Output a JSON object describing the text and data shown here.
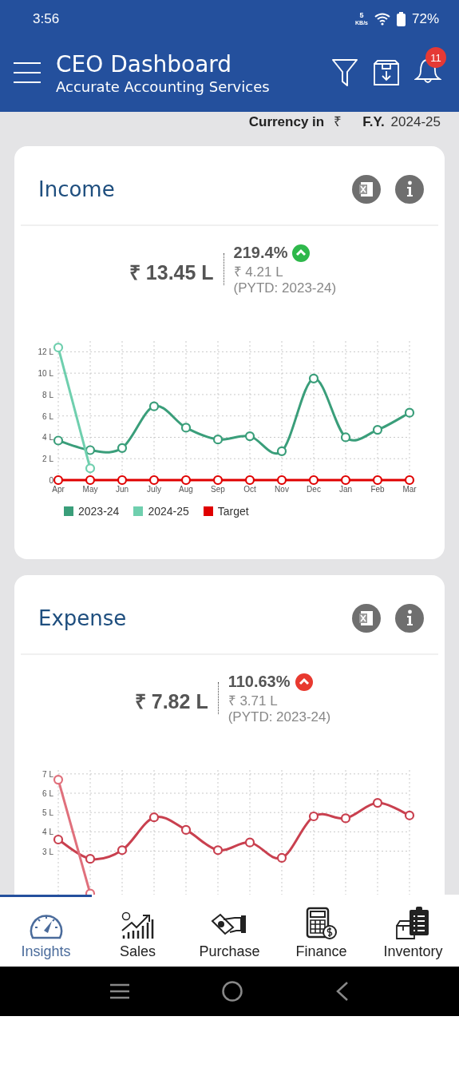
{
  "status_bar": {
    "time": "3:56",
    "net_speed": "5",
    "net_unit": "KB/s",
    "battery": "72%"
  },
  "header": {
    "title": "CEO Dashboard",
    "subtitle": "Accurate Accounting Services",
    "notification_count": "11"
  },
  "filters": {
    "currency_label": "Currency in",
    "currency_symbol": "₹",
    "fy_label": "F.Y.",
    "fy_value": "2024-25"
  },
  "cards": [
    {
      "title": "Income",
      "value": "₹ 13.45 L",
      "change": "219.4%",
      "color": "#2eb84b",
      "previous": "₹ 4.21 L",
      "previous_note": "(PYTD: 2023-24)",
      "chart_data": {
        "type": "line",
        "grid": true,
        "categories": [
          "Apr",
          "May",
          "Jun",
          "July",
          "Aug",
          "Sep",
          "Oct",
          "Nov",
          "Dec",
          "Jan",
          "Feb",
          "Mar"
        ],
        "ylim": [
          0,
          13
        ],
        "yticks": [
          {
            "value": 0,
            "label": "0"
          },
          {
            "value": 2,
            "label": "2 L"
          },
          {
            "value": 4,
            "label": "4 L"
          },
          {
            "value": 6,
            "label": "6 L"
          },
          {
            "value": 8,
            "label": "8 L"
          },
          {
            "value": 10,
            "label": "10 L"
          },
          {
            "value": 12,
            "label": "12 L"
          }
        ],
        "series": [
          {
            "name": "2023-24",
            "color": "#3a9e7a",
            "marker": "circle",
            "values": [
              3.7,
              2.8,
              3.0,
              6.9,
              4.9,
              3.8,
              4.1,
              2.7,
              9.5,
              4.0,
              4.7,
              6.3
            ]
          },
          {
            "name": "2024-25",
            "color": "#6fcfae",
            "marker": "circle",
            "values": [
              12.4,
              1.1,
              null,
              null,
              null,
              null,
              null,
              null,
              null,
              null,
              null,
              null
            ]
          },
          {
            "name": "Target",
            "color": "#e00000",
            "marker": "circle",
            "values": [
              0,
              0,
              0,
              0,
              0,
              0,
              0,
              0,
              0,
              0,
              0,
              0
            ]
          }
        ]
      }
    },
    {
      "title": "Expense",
      "value": "₹ 7.82 L",
      "change": "110.63%",
      "color": "#e8392f",
      "previous": "₹ 3.71 L",
      "previous_note": "(PYTD: 2023-24)",
      "chart_data": {
        "type": "line",
        "grid": true,
        "ylim": [
          0,
          7.2
        ],
        "yticks": [
          {
            "value": 3,
            "label": "3 L"
          },
          {
            "value": 4,
            "label": "4 L"
          },
          {
            "value": 5,
            "label": "5 L"
          },
          {
            "value": 6,
            "label": "6 L"
          },
          {
            "value": 7,
            "label": "7 L"
          }
        ],
        "series": [
          {
            "color": "#c9404f",
            "marker": "circle",
            "values": [
              3.6,
              2.6,
              3.05,
              4.75,
              4.1,
              3.05,
              3.45,
              2.65,
              4.8,
              4.7,
              5.5,
              4.85
            ]
          },
          {
            "color": "#e0707c",
            "marker": "circle",
            "values": [
              6.7,
              0.8,
              null,
              null,
              null,
              null,
              null,
              null,
              null,
              null,
              null,
              null
            ]
          }
        ]
      }
    }
  ],
  "bottom_nav": [
    {
      "label": "Insights",
      "kind": "gauge",
      "selected": true
    },
    {
      "label": "Sales",
      "kind": "growth",
      "selected": false
    },
    {
      "label": "Purchase",
      "kind": "payment",
      "selected": false
    },
    {
      "label": "Finance",
      "kind": "calculator",
      "selected": false
    },
    {
      "label": "Inventory",
      "kind": "stock",
      "selected": false
    }
  ]
}
